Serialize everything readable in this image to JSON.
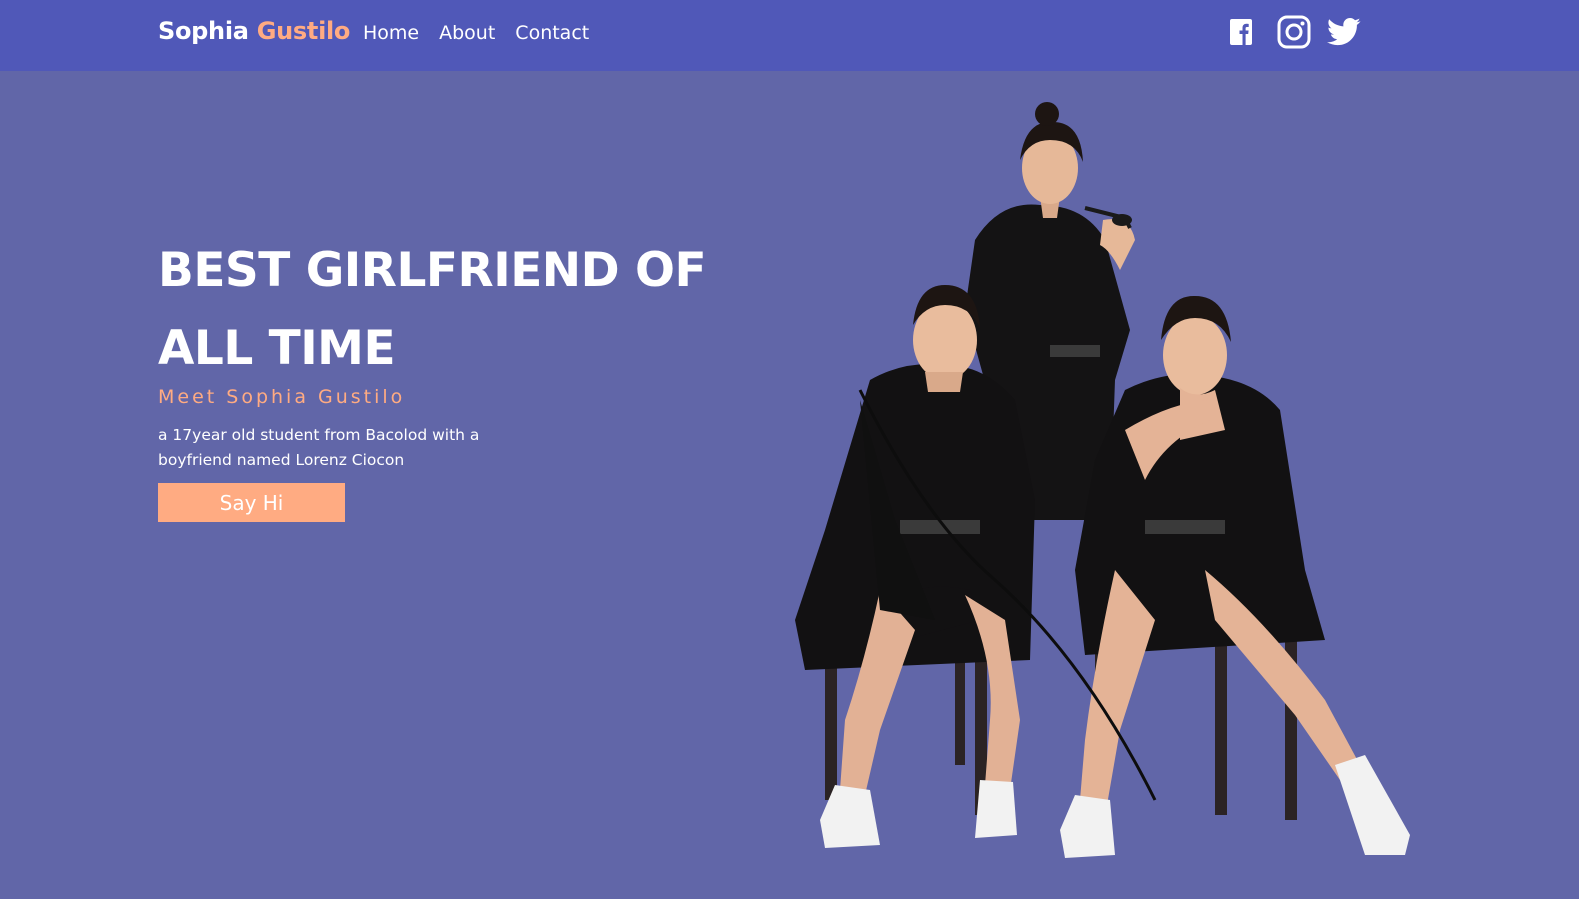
{
  "nav": {
    "brand_first": "Sophia",
    "brand_last": "Gustilo",
    "links": [
      "Home",
      "About",
      "Contact"
    ],
    "social_icons": [
      "facebook-icon",
      "instagram-icon",
      "twitter-icon"
    ]
  },
  "hero": {
    "title": "BEST GIRLFRIEND OF ALL TIME",
    "subtitle": "Meet Sophia Gustilo",
    "description": "a 17year old student from Bacolod with a boyfriend named Lorenz Ciocon",
    "button_label": "Say Hi"
  },
  "colors": {
    "navbar_bg": "#5058b8",
    "page_bg": "#6166a8",
    "accent": "#ffab82",
    "text": "#ffffff"
  }
}
